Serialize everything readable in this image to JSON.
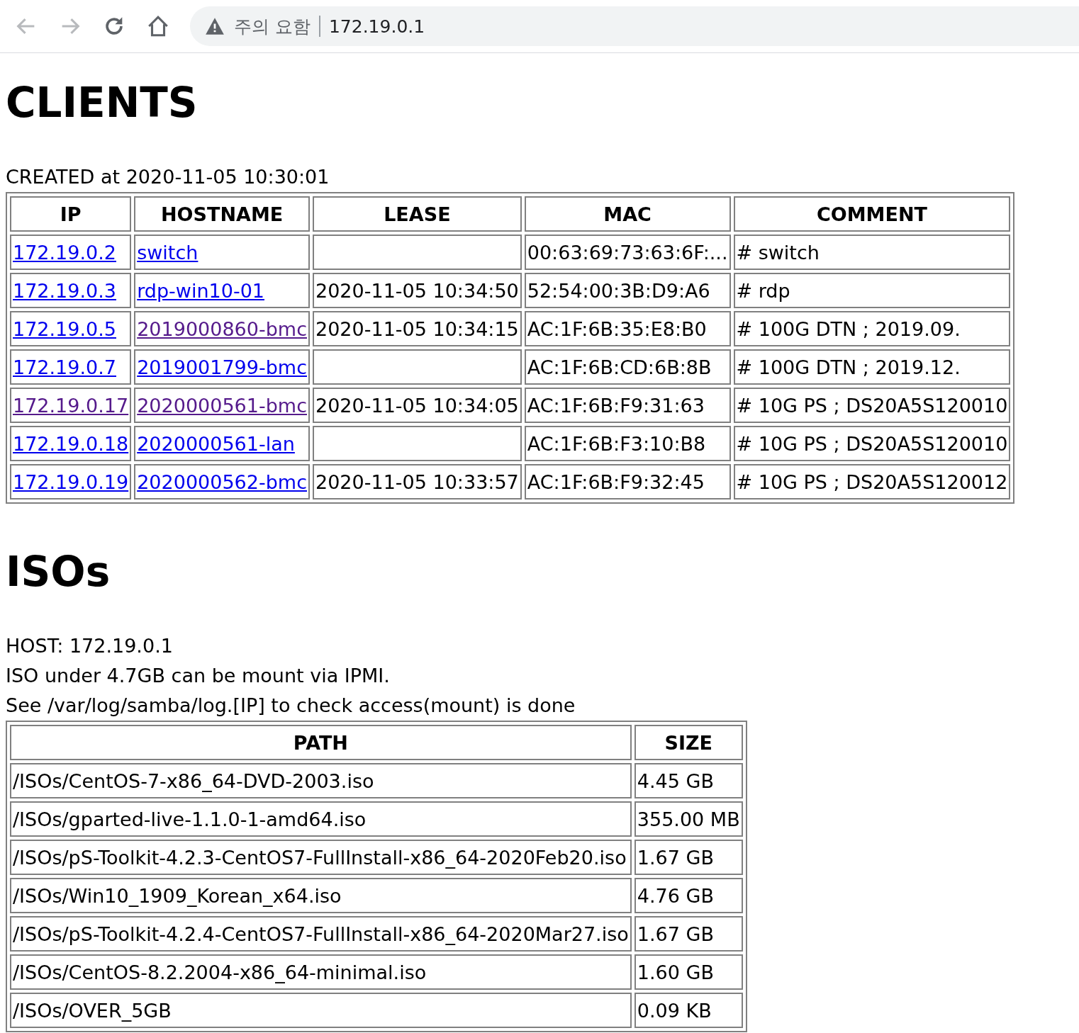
{
  "browser": {
    "back": {
      "disabled": true
    },
    "forward": {
      "disabled": true
    },
    "security_label": "주의 요함",
    "url": "172.19.0.1"
  },
  "clients": {
    "title": "CLIENTS",
    "created": "CREATED at 2020-11-05 10:30:01",
    "columns": [
      "IP",
      "HOSTNAME",
      "LEASE",
      "MAC",
      "COMMENT"
    ],
    "rows": [
      {
        "ip": {
          "text": "172.19.0.2",
          "visited": false
        },
        "hostname": {
          "text": "switch",
          "visited": false
        },
        "mac": "00:63:69:73:63:6F:...",
        "comment": "# switch"
      },
      {
        "ip": {
          "text": "172.19.0.3",
          "visited": false
        },
        "hostname": {
          "text": "rdp-win10-01",
          "visited": false
        },
        "lease": "2020-11-05 10:34:50",
        "mac": "52:54:00:3B:D9:A6",
        "comment": "# rdp"
      },
      {
        "ip": {
          "text": "172.19.0.5",
          "visited": false
        },
        "hostname": {
          "text": "2019000860-bmc",
          "visited": true
        },
        "lease": "2020-11-05 10:34:15",
        "mac": "AC:1F:6B:35:E8:B0",
        "comment": "# 100G DTN ; 2019.09."
      },
      {
        "ip": {
          "text": "172.19.0.7",
          "visited": false
        },
        "hostname": {
          "text": "2019001799-bmc",
          "visited": false
        },
        "mac": "AC:1F:6B:CD:6B:8B",
        "comment": "# 100G DTN ; 2019.12."
      },
      {
        "ip": {
          "text": "172.19.0.17",
          "visited": true
        },
        "hostname": {
          "text": "2020000561-bmc",
          "visited": true
        },
        "lease": "2020-11-05 10:34:05",
        "mac": "AC:1F:6B:F9:31:63",
        "comment": "# 10G PS ; DS20A5S120010"
      },
      {
        "ip": {
          "text": "172.19.0.18",
          "visited": false
        },
        "hostname": {
          "text": "2020000561-lan",
          "visited": false
        },
        "mac": "AC:1F:6B:F3:10:B8",
        "comment": "# 10G PS ; DS20A5S120010"
      },
      {
        "ip": {
          "text": "172.19.0.19",
          "visited": false
        },
        "hostname": {
          "text": "2020000562-bmc",
          "visited": false
        },
        "lease": "2020-11-05 10:33:57",
        "mac": "AC:1F:6B:F9:32:45",
        "comment": "# 10G PS ; DS20A5S120012"
      }
    ]
  },
  "isos": {
    "title": "ISOs",
    "lines": [
      "HOST: 172.19.0.1",
      "ISO under 4.7GB can be mount via IPMI.",
      "See /var/log/samba/log.[IP] to check access(mount) is done"
    ],
    "columns": [
      "PATH",
      "SIZE"
    ],
    "rows": [
      {
        "path": "/ISOs/CentOS-7-x86_64-DVD-2003.iso",
        "size": "4.45 GB"
      },
      {
        "path": "/ISOs/gparted-live-1.1.0-1-amd64.iso",
        "size": "355.00 MB"
      },
      {
        "path": "/ISOs/pS-Toolkit-4.2.3-CentOS7-FullInstall-x86_64-2020Feb20.iso",
        "size": "1.67 GB"
      },
      {
        "path": "/ISOs/Win10_1909_Korean_x64.iso",
        "size": "4.76 GB"
      },
      {
        "path": "/ISOs/pS-Toolkit-4.2.4-CentOS7-FullInstall-x86_64-2020Mar27.iso",
        "size": "1.67 GB"
      },
      {
        "path": "/ISOs/CentOS-8.2.2004-x86_64-minimal.iso",
        "size": "1.60 GB"
      },
      {
        "path": "/ISOs/OVER_5GB",
        "size": "0.09 KB"
      }
    ]
  }
}
